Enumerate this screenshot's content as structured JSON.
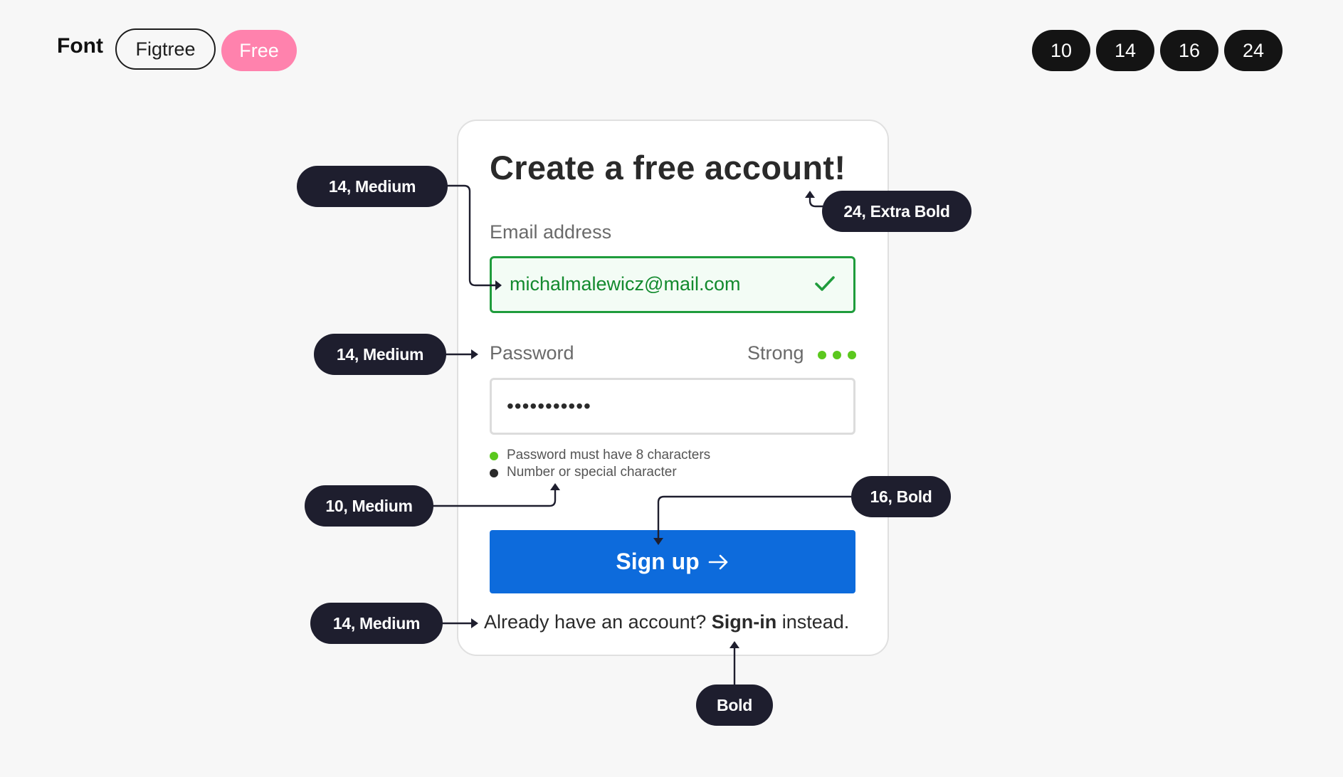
{
  "header": {
    "font_label": "Font",
    "font_name": "Figtree",
    "license_badge": "Free",
    "sizes": [
      "10",
      "14",
      "16",
      "24"
    ]
  },
  "form": {
    "title": "Create a free account!",
    "email_label": "Email address",
    "email_value": "michalmalewicz@mail.com",
    "password_label": "Password",
    "strength_label": "Strong",
    "password_value": "•••••••••••",
    "rules": [
      {
        "text": "Password must have 8 characters",
        "met": true
      },
      {
        "text": "Number or special character",
        "met": false
      }
    ],
    "submit_label": "Sign up",
    "signin_prefix": "Already have an account?",
    "signin_link": "Sign-in",
    "signin_suffix": "instead."
  },
  "annotations": {
    "title_spec": "24, Extra Bold",
    "email_spec": "14, Medium",
    "password_spec": "14, Medium",
    "rules_spec": "10, Medium",
    "button_spec": "16, Bold",
    "footer_spec": "14, Medium",
    "link_spec": "Bold"
  },
  "colors": {
    "brand_blue": "#0d6bdc",
    "success_green": "#1f9c3c",
    "strength_green": "#5bc81e",
    "badge_pink": "#ff82ad",
    "annotation_bg": "#1e1e2e"
  }
}
